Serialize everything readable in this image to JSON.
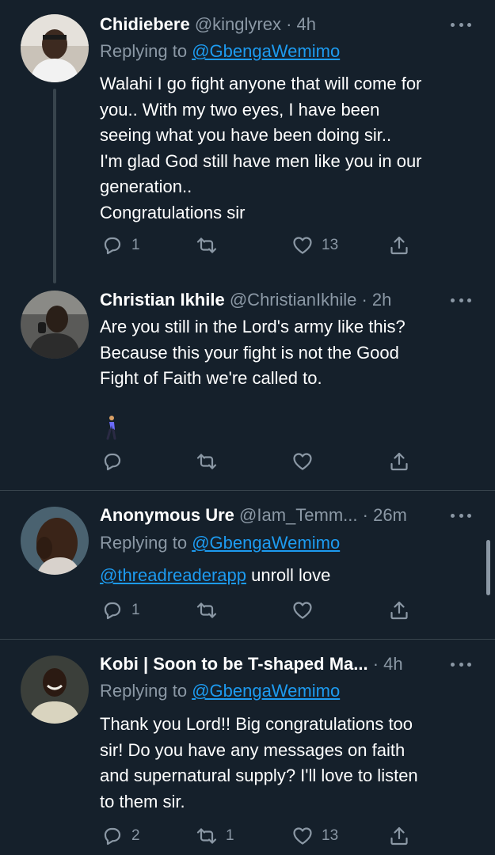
{
  "colors": {
    "background": "#15202b",
    "text_primary": "#ffffff",
    "text_secondary": "#8b98a5",
    "link": "#1d9bf0",
    "divider": "#38444d"
  },
  "tweets": [
    {
      "name": "Chidiebere",
      "handle": "@kinglyrex",
      "time": "· 4h",
      "replying_prefix": "Replying to ",
      "replying_to": "@GbengaWemimo",
      "lines": [
        "Walahi I go fight anyone that will come for",
        "you.. With my two eyes, I have been",
        "seeing what you have been doing sir..",
        "I'm glad God still have men like you in our",
        "generation..",
        "Congratulations sir"
      ],
      "replies": "1",
      "retweets": "",
      "likes": "13"
    },
    {
      "name": "Christian Ikhile",
      "handle": "@ChristianIkhile",
      "time": "· 2h",
      "lines": [
        "Are you still in the Lord's army like this?",
        "Because this your fight is not the Good",
        "Fight of Faith we're called to."
      ],
      "emoji": "person-walking",
      "replies": "",
      "retweets": "",
      "likes": ""
    },
    {
      "name": "Anonymous Ure",
      "handle": "@Iam_Temm...",
      "time": "· 26m",
      "replying_prefix": "Replying to ",
      "replying_to": "@GbengaWemimo",
      "mention": "@threadreaderapp",
      "text_after_mention": " unroll love",
      "replies": "1",
      "retweets": "",
      "likes": ""
    },
    {
      "name": "Kobi | Soon to be T-shaped Ma...",
      "handle": "",
      "time": "· 4h",
      "replying_prefix": "Replying to ",
      "replying_to": "@GbengaWemimo",
      "lines": [
        "Thank you Lord!! Big congratulations too",
        "sir! Do you have any messages on faith",
        "and supernatural supply? I'll love to listen",
        "to them sir."
      ],
      "replies": "2",
      "retweets": "1",
      "likes": "13"
    }
  ]
}
